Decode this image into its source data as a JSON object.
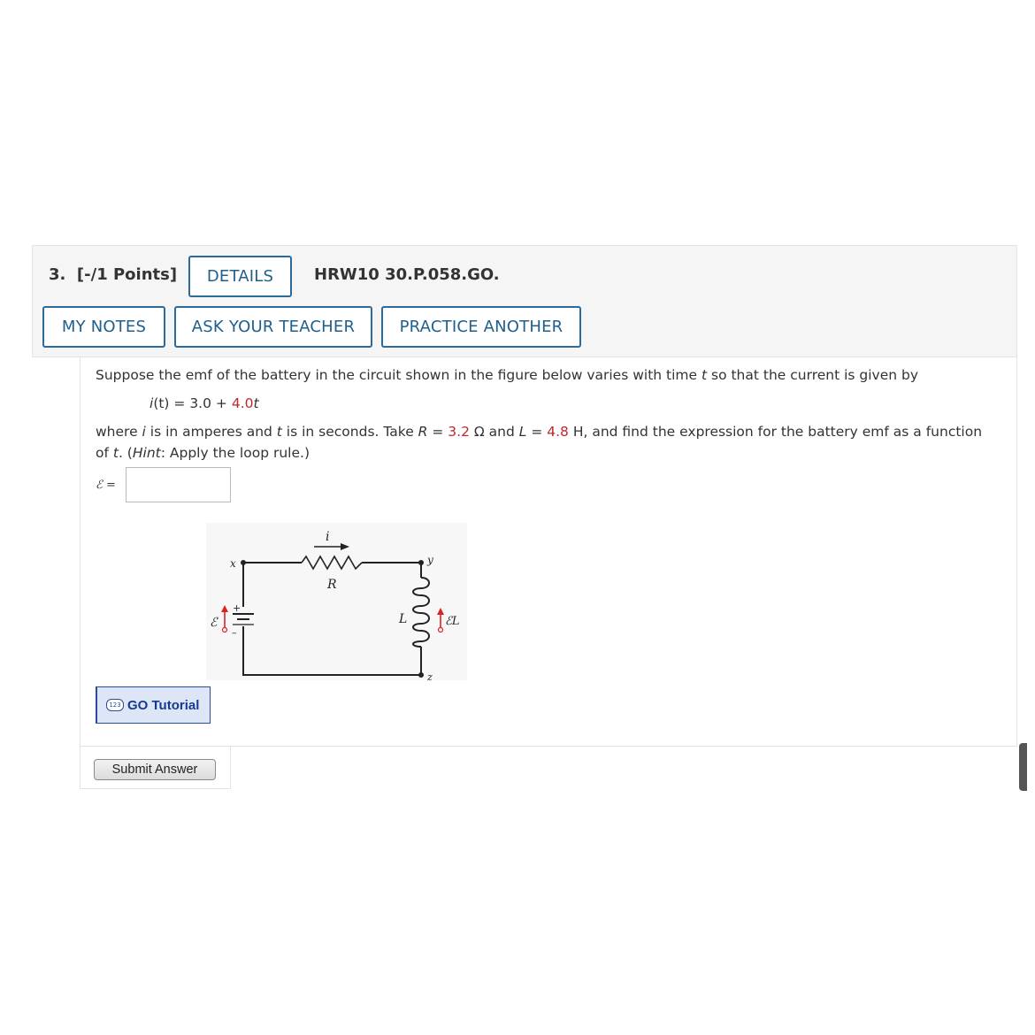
{
  "question": {
    "number": "3.",
    "points": "[-/1 Points]",
    "details_label": "DETAILS",
    "id": "HRW10 30.P.058.GO."
  },
  "actions": {
    "my_notes": "MY NOTES",
    "ask_teacher": "ASK YOUR TEACHER",
    "practice_another": "PRACTICE ANOTHER"
  },
  "problem": {
    "line1_pre": "Suppose the emf of the battery in the circuit shown in the figure below varies with time ",
    "line1_var": "t",
    "line1_post": " so that the current is given by",
    "eq_lhs_i": "i",
    "eq_lhs_rest": "(t) = 3.0 + ",
    "eq_coef": "4.0",
    "eq_t": "t",
    "line2_a": "where ",
    "line2_i": "i",
    "line2_b": " is in amperes and ",
    "line2_t": "t",
    "line2_c": " is in seconds. Take ",
    "line2_R": "R",
    "line2_d": " = ",
    "R_value": "3.2",
    "line2_e": " Ω and ",
    "line2_L": "L",
    "line2_f": " = ",
    "L_value": "4.8",
    "line2_g": " H, and find the expression for the battery emf as a function",
    "line3_a": "of ",
    "line3_t": "t",
    "line3_b": ". (",
    "line3_hint": "Hint",
    "line3_c": ": Apply the loop rule.)",
    "answer_label": "ℰ =",
    "answer_value": ""
  },
  "figure": {
    "current_label": "i",
    "resistor_label": "R",
    "inductor_label": "L",
    "emf_label": "ℰ",
    "emf_L_label": "ℰL",
    "node_x": "x",
    "node_y": "y",
    "node_z": "z",
    "plus_sign": "+",
    "minus_sign": "–"
  },
  "tutorial": {
    "icon_text": "123",
    "label": "GO Tutorial"
  },
  "submit": {
    "label": "Submit Answer"
  }
}
